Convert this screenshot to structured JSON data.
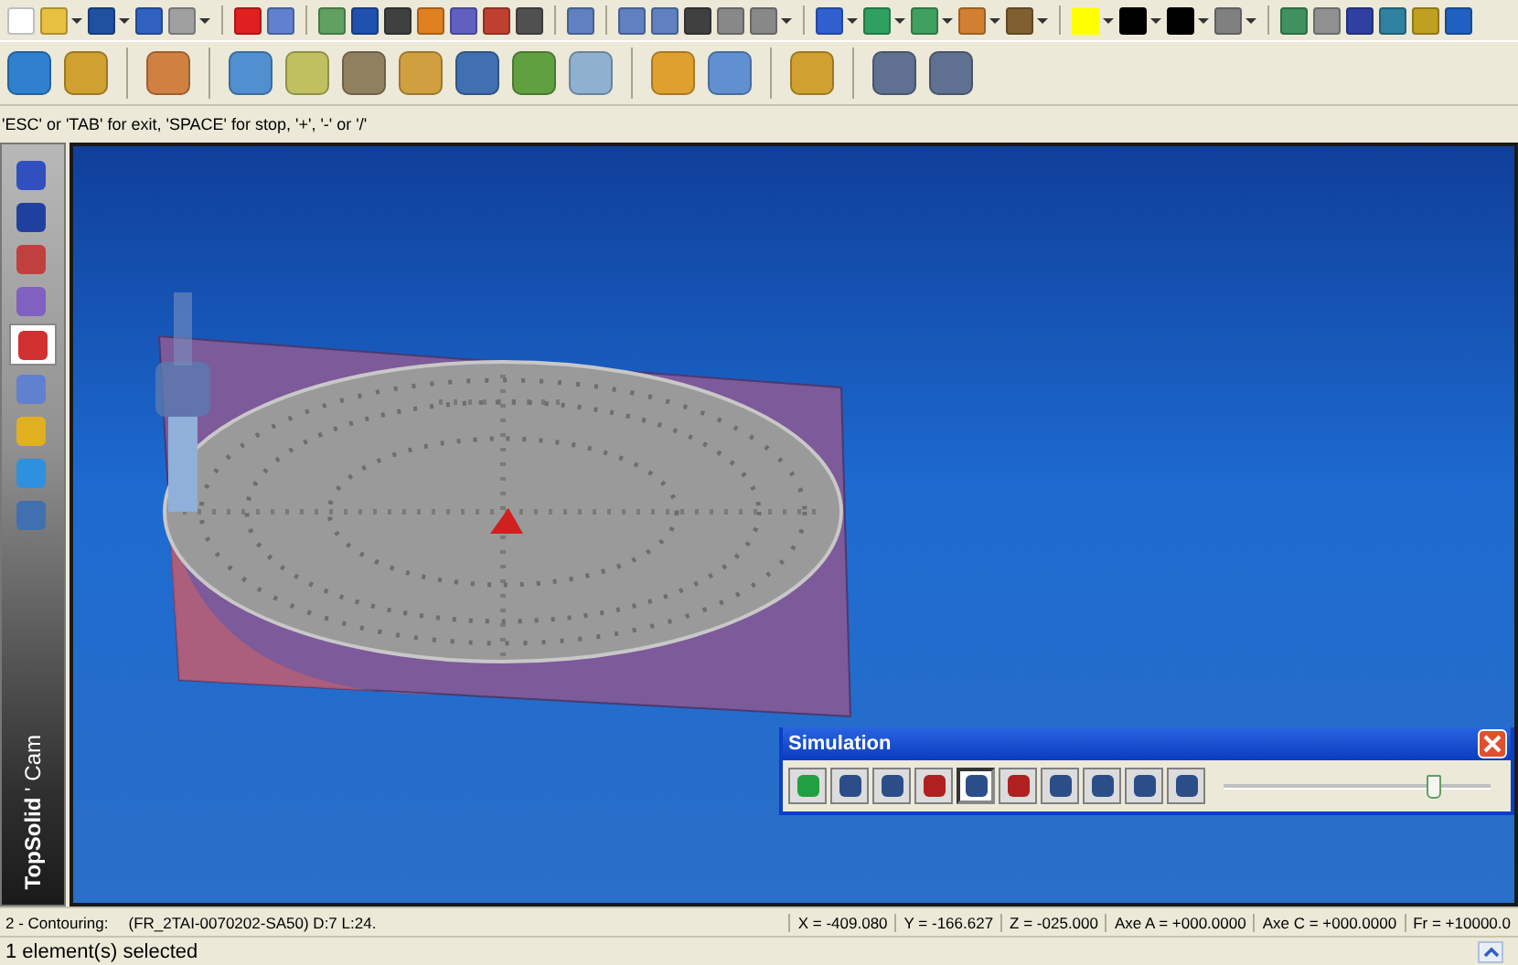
{
  "hint": "'ESC' or 'TAB' for exit, 'SPACE' for stop, '+', '-' or '/'",
  "sidebar": {
    "items": [
      {
        "selected": false
      },
      {
        "selected": false
      },
      {
        "selected": false
      },
      {
        "selected": false
      },
      {
        "selected": true
      },
      {
        "selected": false
      },
      {
        "selected": false
      },
      {
        "selected": false
      },
      {
        "selected": false
      }
    ],
    "brand": "**TopSolid** ' Cam"
  },
  "simulation": {
    "title": "Simulation",
    "buttons": [
      {
        "pressed": false
      },
      {
        "pressed": false
      },
      {
        "pressed": false
      },
      {
        "pressed": false
      },
      {
        "pressed": true
      },
      {
        "pressed": false
      },
      {
        "pressed": false
      },
      {
        "pressed": false
      },
      {
        "pressed": false
      },
      {
        "pressed": false
      }
    ],
    "speed": {
      "level": 0.78
    }
  },
  "status_bar": {
    "operation": "2 - Contouring:",
    "tool": "(FR_2TAI-0070202-SA50) D:7 L:24.",
    "readouts": [
      "X = -409.080",
      "Y = -166.627",
      "Z = -025.000",
      "Axe A = +000.0000",
      "Axe C = +000.0000",
      "Fr = +10000.0"
    ]
  },
  "message": "1 element(s) selected"
}
